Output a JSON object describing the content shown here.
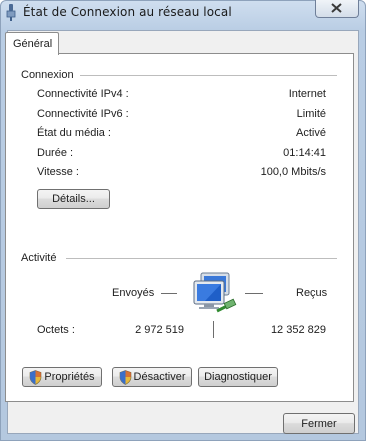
{
  "window": {
    "title": "État de Connexion au réseau local"
  },
  "tabs": [
    {
      "label": "Général"
    }
  ],
  "connexion": {
    "heading": "Connexion",
    "rows": [
      {
        "label": "Connectivité IPv4 :",
        "value": "Internet"
      },
      {
        "label": "Connectivité IPv6 :",
        "value": "Limité"
      },
      {
        "label": "État du média :",
        "value": "Activé"
      },
      {
        "label": "Durée :",
        "value": "01:14:41"
      },
      {
        "label": "Vitesse :",
        "value": "100,0 Mbits/s"
      }
    ],
    "details_label": "Détails..."
  },
  "activite": {
    "heading": "Activité",
    "sent_label": "Envoyés",
    "received_label": "Reçus",
    "bytes_label": "Octets :",
    "bytes_sent": "2 972 519",
    "bytes_received": "12 352 829"
  },
  "actions": {
    "properties_label": "Propriétés",
    "disable_label": "Désactiver",
    "diagnose_label": "Diagnostiquer"
  },
  "footer": {
    "close_label": "Fermer"
  },
  "icons": {
    "title": "network-connector-icon",
    "close": "close-icon",
    "shield": "uac-shield-icon",
    "activity": "network-computer-icon"
  }
}
